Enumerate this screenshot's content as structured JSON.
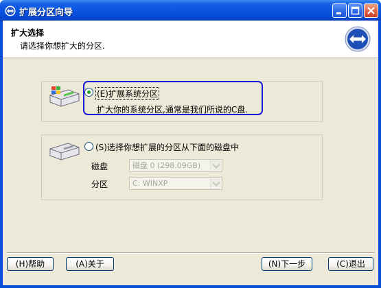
{
  "window": {
    "title": "扩展分区向导"
  },
  "header": {
    "title": "扩大选择",
    "subtitle": "请选择你想扩大的分区."
  },
  "options": {
    "system": {
      "label": "(E)扩展系统分区",
      "description": "扩大你的系统分区,通常是我们所说的C盘.",
      "selected": true
    },
    "other": {
      "label": "(S)选择你想扩展的分区从下面的磁盘中",
      "selected": false,
      "disk_label": "磁盘",
      "disk_value": "磁盘 0 (298.09GB)",
      "partition_label": "分区",
      "partition_value": "C: WINXP"
    }
  },
  "buttons": {
    "help": "(H)帮助",
    "about": "(A)关于",
    "next": "(N)下一步",
    "exit": "(C)退出"
  },
  "colors": {
    "titlebar": "#0a55e0",
    "highlight": "#1a1ad6",
    "client": "#ece9d8"
  }
}
